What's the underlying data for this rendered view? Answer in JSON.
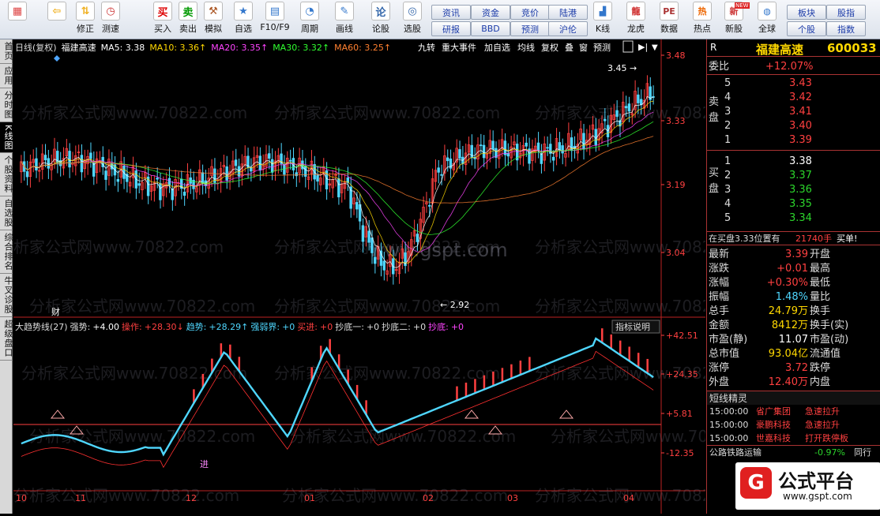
{
  "toolbar": {
    "buttons": [
      {
        "label": "",
        "icon": "grid-icon"
      },
      {
        "label": "",
        "icon": "back-arrow-icon"
      },
      {
        "label": "修正",
        "icon": "up-down-arrow-icon"
      },
      {
        "label": "测速",
        "icon": "speed-icon"
      },
      {
        "label": "买入",
        "icon": "buy-icon"
      },
      {
        "label": "卖出",
        "icon": "sell-icon"
      },
      {
        "label": "模拟",
        "icon": "hammer-icon"
      },
      {
        "label": "自选",
        "icon": "star-icon"
      },
      {
        "label": "F10/F9",
        "icon": "table-icon"
      },
      {
        "label": "周期",
        "icon": "clock-icon"
      },
      {
        "label": "画线",
        "icon": "pencil-icon"
      },
      {
        "label": "论股",
        "icon": "chat-icon"
      },
      {
        "label": "选股",
        "icon": "pick-icon"
      }
    ],
    "small_buttons": [
      [
        "资讯",
        "资金",
        "竞价",
        "陆港"
      ],
      [
        "研报",
        "BBD",
        "预测",
        "沪伦"
      ]
    ],
    "right_buttons": [
      {
        "label": "K线",
        "icon": "kline-icon"
      },
      {
        "label": "龙虎",
        "icon": "dragon-icon"
      },
      {
        "label": "数据",
        "icon": "pe-icon"
      },
      {
        "label": "热点",
        "icon": "hot-icon"
      },
      {
        "label": "新股",
        "icon": "newstock-icon"
      },
      {
        "label": "全球",
        "icon": "globe-icon"
      }
    ],
    "board_buttons": [
      [
        "板块",
        "股指"
      ],
      [
        "个股",
        "指数"
      ]
    ],
    "new_icon_text": "NEW"
  },
  "sidebar": {
    "tabs": [
      "首页",
      "应用",
      "分时图",
      "K线图",
      "个股资料",
      "自选股",
      "综合排名",
      "牛叉诊股",
      "超级盘口"
    ],
    "active_index": 3
  },
  "chart": {
    "title_left": "日线(复权)",
    "stock": "福建高速",
    "ma_labels": [
      {
        "text": "MA5: 3.38",
        "color": "#ffffff"
      },
      {
        "text": "MA10: 3.36↑",
        "color": "#ffd800"
      },
      {
        "text": "MA20: 3.35↑",
        "color": "#ff44ff"
      },
      {
        "text": "MA30: 3.32↑",
        "color": "#30ff30"
      },
      {
        "text": "MA60: 3.25↑",
        "color": "#ff8030"
      }
    ],
    "menu": [
      "九转",
      "重大事件",
      "加自选",
      "均线",
      "复权",
      "叠",
      "窗",
      "预测"
    ],
    "y_labels": [
      "3.48",
      "3.33",
      "3.19",
      "3.04"
    ],
    "high_label": "3.45",
    "low_label": "2.92",
    "cai": "财",
    "ind_header": [
      {
        "text": "大趋势线(27)",
        "color": "#dddddd"
      },
      {
        "text": "强势:",
        "color": "#dddddd"
      },
      {
        "text": "+4.00",
        "color": "#ffffff"
      },
      {
        "text": "操作:",
        "color": "#ff4040"
      },
      {
        "text": "+28.30↓",
        "color": "#ff4040"
      },
      {
        "text": "趋势:",
        "color": "#4fd7ff"
      },
      {
        "text": "+28.29↑",
        "color": "#4fd7ff"
      },
      {
        "text": "强弱界:",
        "color": "#4fd7ff"
      },
      {
        "text": "+0",
        "color": "#4fd7ff"
      },
      {
        "text": "买进:",
        "color": "#ff4040"
      },
      {
        "text": "+0",
        "color": "#ff4040"
      },
      {
        "text": "抄底一:",
        "color": "#dddddd"
      },
      {
        "text": "+0",
        "color": "#dddddd"
      },
      {
        "text": "抄底二:",
        "color": "#dddddd"
      },
      {
        "text": "+0",
        "color": "#dddddd"
      },
      {
        "text": "抄底:",
        "color": "#ff44ff"
      },
      {
        "text": "+0",
        "color": "#ff44ff"
      }
    ],
    "ind_button": "指标说明",
    "ind_y_labels": [
      "+42.51",
      "+24.35",
      "+5.81",
      "-12.35"
    ],
    "marker_jin": "进",
    "x_labels": [
      "10",
      "11",
      "12",
      "01",
      "02",
      "03",
      "04"
    ],
    "watermark": "分析家公式网www.70822.com",
    "watermark2": "www.gspt.com"
  },
  "quote": {
    "r": "R",
    "name": "福建高速",
    "code": "600033",
    "weibi_label": "委比",
    "weibi": "+12.07%",
    "sell_label": "卖盘",
    "buy_label": "买盘",
    "sell": [
      {
        "n": "5",
        "p": "3.43"
      },
      {
        "n": "4",
        "p": "3.42"
      },
      {
        "n": "3",
        "p": "3.41"
      },
      {
        "n": "2",
        "p": "3.40"
      },
      {
        "n": "1",
        "p": "3.39"
      }
    ],
    "buy": [
      {
        "n": "1",
        "p": "3.38"
      },
      {
        "n": "2",
        "p": "3.37"
      },
      {
        "n": "3",
        "p": "3.36"
      },
      {
        "n": "4",
        "p": "3.35"
      },
      {
        "n": "5",
        "p": "3.34"
      }
    ],
    "notice_text": "在买盘3.33位置有",
    "notice_vol": "21740手",
    "notice_tail": "买单!",
    "stats": [
      [
        "最新",
        "3.39",
        "开盘",
        ""
      ],
      [
        "涨跌",
        "+0.01",
        "最高",
        ""
      ],
      [
        "涨幅",
        "+0.30%",
        "最低",
        ""
      ],
      [
        "振幅",
        "1.48%",
        "量比",
        ""
      ],
      [
        "总手",
        "24.79万",
        "换手",
        ""
      ],
      [
        "金额",
        "8412万",
        "换手(实)",
        ""
      ],
      [
        "市盈(静)",
        "11.07",
        "市盈(动)",
        ""
      ],
      [
        "总市值",
        "93.04亿",
        "流通值",
        ""
      ],
      [
        "涨停",
        "3.72",
        "跌停",
        ""
      ],
      [
        "外盘",
        "12.40万",
        "内盘",
        ""
      ]
    ],
    "short_title": "短线精灵",
    "short": [
      [
        "15:00:00",
        "省广集团",
        "急速拉升"
      ],
      [
        "15:00:00",
        "豪鹏科技",
        "急速拉升"
      ],
      [
        "15:00:00",
        "世嘉科技",
        "打开跌停板"
      ]
    ],
    "sector": "公路铁路运输",
    "sector_pct": "-0.97%",
    "tail_label": "同行",
    "logo_text": "公式平台",
    "logo_url": "www.gspt.com"
  },
  "colors": {
    "up": "#ff4040",
    "down": "#4fd7ff",
    "ma5": "#ffffff",
    "trend": "#4fd7ff"
  }
}
